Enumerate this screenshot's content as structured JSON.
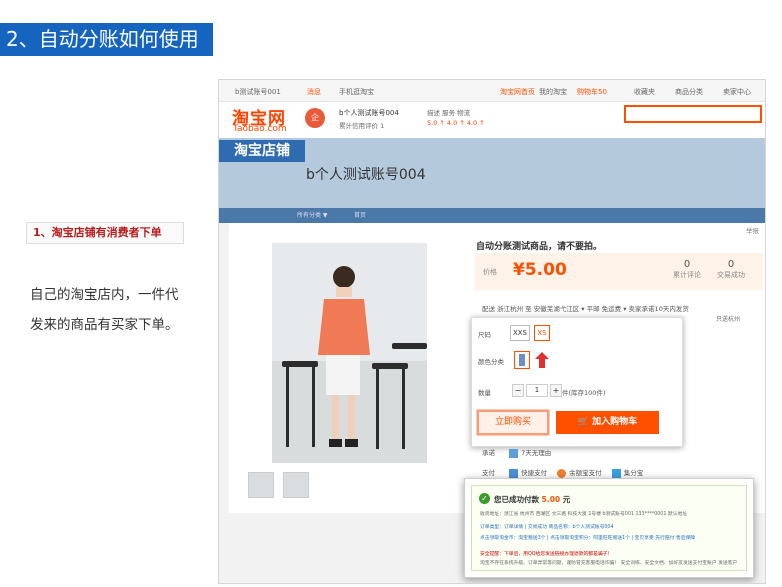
{
  "slide": {
    "title": "2、自动分账如何使用",
    "step_label": "1、淘宝店铺有消费者下单",
    "step_desc": "自己的淘宝店内，一件代发来的商品有买家下单。"
  },
  "topbar": {
    "account": "b测试账号001",
    "messages": "消息",
    "mobile": "手机逛淘宝",
    "home": "淘宝网首页",
    "my_taobao": "我的淘宝",
    "cart": "购物车50",
    "favorites": "收藏夹",
    "categories": "商品分类",
    "seller_center": "卖家中心"
  },
  "header": {
    "logo_cn": "淘宝网",
    "logo_en": "Taobao.com",
    "shop_badge": "企",
    "shop_mini_name": "b个人测试账号004",
    "shop_credit": "累计信用评价 1",
    "rating_labels": "描述  服务  物流",
    "rating_values": "5.0 ↑  4.0 ↑  4.0 ↑"
  },
  "banner": {
    "tag": "淘宝店铺",
    "shop_name": "b个人测试账号004"
  },
  "nav": {
    "all_categories": "所有分类 ▼",
    "home": "首页"
  },
  "product": {
    "report": "举报",
    "title": "自动分账测试商品，请不要拍。",
    "price_label": "价格",
    "price": "¥5.00",
    "reviews_count": "0",
    "reviews_label": "累计评论",
    "deals_count": "0",
    "deals_label": "交易成功",
    "shipping": "配送    浙江杭州 至 安徽芜湖弋江区 ▾  平邮 免运费 ▾  卖家承诺10天内发货",
    "shipping_note": "只送杭州"
  },
  "popup": {
    "size_label": "尺码",
    "sizes": [
      "XXS",
      "XS"
    ],
    "color_label": "颜色分类",
    "qty_label": "数量",
    "qty_minus": "−",
    "qty_value": "1",
    "qty_plus": "+",
    "stock_note": "件(库存100件)",
    "buy_now": "立即购买",
    "add_cart": "加入购物车"
  },
  "service": {
    "promise_label": "承诺",
    "promise_value": "7天无理由",
    "pay_label": "支付",
    "pay_options": [
      "快捷支付",
      "余额宝支付",
      "集分宝"
    ]
  },
  "success": {
    "title_prefix": "您已成功付款",
    "amount": "5.00",
    "title_suffix": "元",
    "line1": "收货地址：浙江省 杭州市 西湖区 文三路 科技大厦 1号楼 b测试账号001 133****0001 默认地址",
    "line2": "订单类型：订单详情 | 交易成功  商品名称：b个人测试账号004",
    "line3": "点击领取淘金币：淘宝赠送3个  |  点击领取淘宝积分：阿里旺旺赠送1个  |  宝贝享受 先行赔付 售后保障",
    "line4": "安全提醒：下单后，用QQ给您发送链接办理退款的都是骗子！",
    "line5": "淘宝不存在系统升级、订单异常等问题，谨防冒充客服电话诈骗！ 安全训练、安全文档、加好友发送支付宝账户 发送客户"
  },
  "colors": {
    "accent": "#ff5000",
    "title_bg": "#1565c0",
    "banner_bg": "#b5c9dd",
    "nav_bg": "#4a78a8",
    "step_label": "#b71c1c"
  }
}
